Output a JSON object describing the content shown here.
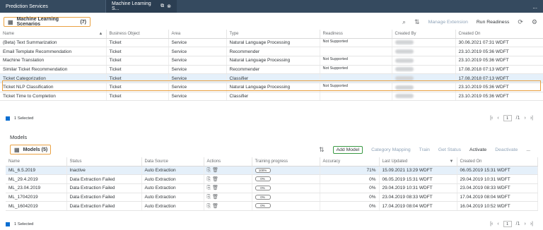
{
  "tabs": [
    {
      "label": "Prediction Services"
    },
    {
      "label": "Machine Learning S..."
    }
  ],
  "top_more": "...",
  "scenarios": {
    "title": "Machine Learning Scenarios",
    "count": "(7)",
    "toolbar": {
      "manage_extension": "Manage Extension",
      "run_readiness": "Run Readiness"
    },
    "columns": [
      "Name",
      "Business Object",
      "Area",
      "Type",
      "Readiness",
      "Created By",
      "Created On"
    ],
    "rows": [
      {
        "name": "(Beta) Text Summarization",
        "bo": "Ticket",
        "area": "Service",
        "type": "Natural Language Processing",
        "readiness": "Not Supported",
        "created_on": "30.06.2021 07:31 WDFT"
      },
      {
        "name": "Email Template Recommendation",
        "bo": "Ticket",
        "area": "Service",
        "type": "Recommender",
        "readiness": "",
        "created_on": "23.10.2019 05:36 WDFT"
      },
      {
        "name": "Machine Translation",
        "bo": "Ticket",
        "area": "Service",
        "type": "Natural Language Processing",
        "readiness": "Not Supported",
        "created_on": "23.10.2019 05:36 WDFT"
      },
      {
        "name": "Similar Ticket Recommendation",
        "bo": "Ticket",
        "area": "Service",
        "type": "Recommender",
        "readiness": "Not Supported",
        "created_on": "17.08.2018 07:13 WDFT"
      },
      {
        "name": "Ticket Categorization",
        "bo": "Ticket",
        "area": "Service",
        "type": "Classifier",
        "readiness": "",
        "created_on": "17.08.2018 07:13 WDFT"
      },
      {
        "name": "Ticket NLP Classification",
        "bo": "Ticket",
        "area": "Service",
        "type": "Natural Language Processing",
        "readiness": "Not Supported",
        "created_on": "23.10.2019 05:36 WDFT"
      },
      {
        "name": "Ticket Time to Completion",
        "bo": "Ticket",
        "area": "Service",
        "type": "Classifier",
        "readiness": "",
        "created_on": "23.10.2019 05:36 WDFT"
      }
    ],
    "footer": "1 Selected",
    "page": "1",
    "page_total": "/1"
  },
  "models": {
    "section_label": "Models",
    "title": "Models",
    "count": "(5)",
    "toolbar": {
      "add_model": "Add Model",
      "category_mapping": "Category Mapping",
      "train": "Train",
      "get_status": "Get Status",
      "activate": "Activate",
      "deactivate": "Deactivate",
      "more": "..."
    },
    "columns": [
      "Name",
      "Status",
      "Data Source",
      "Actions",
      "Training progress",
      "Accuracy",
      "Last Updated",
      "Created On"
    ],
    "rows": [
      {
        "name": "ML_6.5.2019",
        "status": "Inactive",
        "source": "Auto Extraction",
        "progress": "100%",
        "accuracy": "71%",
        "updated": "15.09.2021 13:29 WDFT",
        "created": "06.05.2019 15:31 WDFT"
      },
      {
        "name": "ML_29.4.2019",
        "status": "Data Extraction Failed",
        "source": "Auto Extraction",
        "progress": "0%",
        "accuracy": "0%",
        "updated": "06.05.2019 15:31 WDFT",
        "created": "29.04.2019 10:31 WDFT"
      },
      {
        "name": "ML_23.04.2019",
        "status": "Data Extraction Failed",
        "source": "Auto Extraction",
        "progress": "0%",
        "accuracy": "0%",
        "updated": "29.04.2019 10:31 WDFT",
        "created": "23.04.2019 08:33 WDFT"
      },
      {
        "name": "ML_17042019",
        "status": "Data Extraction Failed",
        "source": "Auto Extraction",
        "progress": "0%",
        "accuracy": "0%",
        "updated": "23.04.2019 08:33 WDFT",
        "created": "17.04.2019 08:04 WDFT"
      },
      {
        "name": "ML_16042019",
        "status": "Data Extraction Failed",
        "source": "Auto Extraction",
        "progress": "0%",
        "accuracy": "0%",
        "updated": "17.04.2019 08:04 WDFT",
        "created": "16.04.2019 10:52 WDFT"
      }
    ],
    "footer": "1 Selected",
    "page": "1",
    "page_total": "/1"
  }
}
